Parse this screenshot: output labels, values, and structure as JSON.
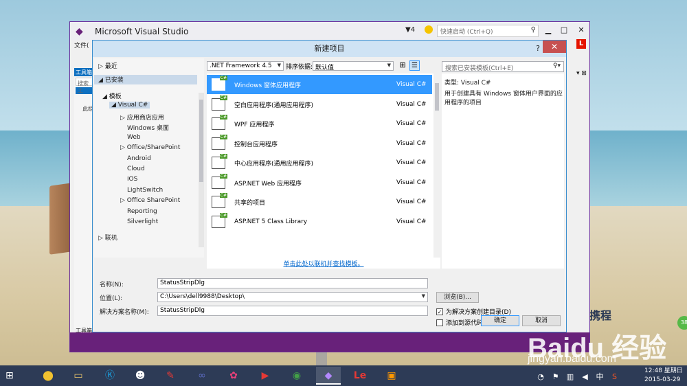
{
  "vs_window": {
    "title": "Microsoft Visual Studio",
    "notification_count": "4",
    "quick_launch_placeholder": "快速启动 (Ctrl+Q)",
    "menu_first": "文件(",
    "toolbox_header": "工具箱",
    "toolbox_search": "搜索工",
    "toolbox_text": "此组",
    "toolbox_bottom": "工具箱",
    "user_badge": "L"
  },
  "dialog": {
    "title": "新建项目",
    "help": "?",
    "close": "✕",
    "tree": {
      "recent": "最近",
      "installed": "已安装",
      "templates": "模板",
      "visual_csharp": "Visual C#",
      "children": [
        "应用商店应用",
        "Windows 桌面",
        "Web",
        "Office/SharePoint",
        "Android",
        "Cloud",
        "iOS",
        "LightSwitch",
        "Office SharePoint",
        "Reporting",
        "Silverlight"
      ],
      "online": "联机"
    },
    "framework": ".NET Framework 4.5",
    "sort_label": "排序依据:",
    "sort_value": "默认值",
    "templates": [
      {
        "name": "Windows 窗体应用程序",
        "lang": "Visual C#"
      },
      {
        "name": "空白应用程序(通用应用程序)",
        "lang": "Visual C#"
      },
      {
        "name": "WPF 应用程序",
        "lang": "Visual C#"
      },
      {
        "name": "控制台应用程序",
        "lang": "Visual C#"
      },
      {
        "name": "中心应用程序(通用应用程序)",
        "lang": "Visual C#"
      },
      {
        "name": "ASP.NET Web 应用程序",
        "lang": "Visual C#"
      },
      {
        "name": "共享的项目",
        "lang": "Visual C#"
      },
      {
        "name": "ASP.NET 5 Class Library",
        "lang": "Visual C#"
      }
    ],
    "online_link": "单击此处以联机并查找模板。",
    "search_placeholder": "搜索已安装模板(Ctrl+E)",
    "info_type": "类型: Visual C#",
    "info_desc": "用于创建具有 Windows 窗体用户界面的应用程序的项目",
    "form": {
      "name_label": "名称(N):",
      "name_value": "StatusStripDlg",
      "location_label": "位置(L):",
      "location_value": "C:\\Users\\dell9988\\Desktop\\",
      "solution_label": "解决方案名称(M):",
      "solution_value": "StatusStripDlg",
      "browse": "浏览(B)...",
      "create_dir": "为解决方案创建目录(D)",
      "create_dir_checked": true,
      "source_control": "添加到源代码管理(U)",
      "source_control_checked": false,
      "ok": "确定",
      "cancel": "取消"
    }
  },
  "watermark": {
    "brand": "Baidu 经验",
    "url": "jingyan.baidu.com",
    "guide": "携程",
    "badge": "38"
  },
  "taskbar": {
    "time": "12:48 星期日",
    "date": "2015-03-29",
    "ime": "中"
  }
}
